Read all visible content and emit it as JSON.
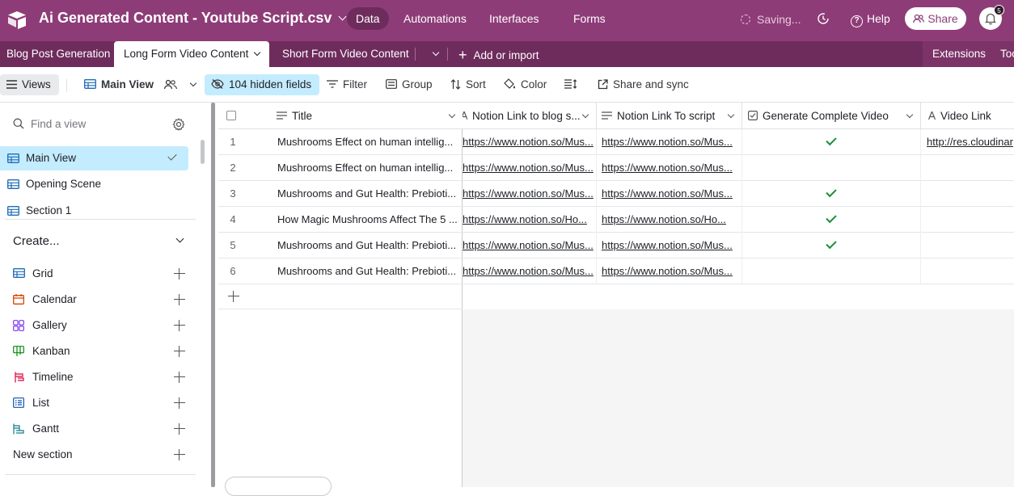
{
  "app": {
    "base_title": "Ai Generated Content - Youtube Script.csv",
    "nav": [
      "Data",
      "Automations",
      "Interfaces",
      "Forms"
    ],
    "saving": "Saving...",
    "help": "Help",
    "share": "Share",
    "notification_count": "5",
    "accent": "#8e3c78"
  },
  "tabs": {
    "items": [
      "Blog Post Generation",
      "Long Form Video Content",
      "Short Form Video Content"
    ],
    "active": "Long Form Video Content",
    "add_import": "Add or import",
    "extensions": "Extensions",
    "tools": "Too"
  },
  "toolbar": {
    "views": "Views",
    "view_name": "Main View",
    "hidden_fields": "104 hidden fields",
    "filter": "Filter",
    "group": "Group",
    "sort": "Sort",
    "color": "Color",
    "share_sync": "Share and sync"
  },
  "sidebar": {
    "find_placeholder": "Find a view",
    "views": [
      "Main View",
      "Opening Scene",
      "Section 1"
    ],
    "create_label": "Create...",
    "create_items": [
      {
        "label": "Grid",
        "icon": "grid-icon"
      },
      {
        "label": "Calendar",
        "icon": "calendar-icon"
      },
      {
        "label": "Gallery",
        "icon": "gallery-icon"
      },
      {
        "label": "Kanban",
        "icon": "kanban-icon"
      },
      {
        "label": "Timeline",
        "icon": "timeline-icon"
      },
      {
        "label": "List",
        "icon": "list-icon"
      },
      {
        "label": "Gantt",
        "icon": "gantt-icon"
      }
    ],
    "new_section": "New section"
  },
  "grid": {
    "columns": [
      "Title",
      "Notion Link to blog s...",
      "Notion Link To script",
      "Generate Complete Video",
      "Video Link"
    ],
    "rows": [
      {
        "num": "1",
        "title": "Mushrooms Effect on human intellig...",
        "blog": "https://www.notion.so/Mus...",
        "script": "https://www.notion.so/Mus...",
        "generate": true,
        "video": "http://res.cloudinar"
      },
      {
        "num": "2",
        "title": "Mushrooms Effect on human intellig...",
        "blog": "https://www.notion.so/Mus...",
        "script": "https://www.notion.so/Mus...",
        "generate": false,
        "video": ""
      },
      {
        "num": "3",
        "title": "Mushrooms and Gut Health: Prebioti...",
        "blog": "https://www.notion.so/Mus...",
        "script": "https://www.notion.so/Mus...",
        "generate": true,
        "video": ""
      },
      {
        "num": "4",
        "title": "How Magic Mushrooms Affect The 5 ...",
        "blog": "https://www.notion.so/Ho...",
        "script": "https://www.notion.so/Ho...",
        "generate": true,
        "video": ""
      },
      {
        "num": "5",
        "title": "Mushrooms and Gut Health: Prebioti...",
        "blog": "https://www.notion.so/Mus...",
        "script": "https://www.notion.so/Mus...",
        "generate": true,
        "video": ""
      },
      {
        "num": "6",
        "title": "Mushrooms and Gut Health: Prebioti...",
        "blog": "https://www.notion.so/Mus...",
        "script": "https://www.notion.so/Mus...",
        "generate": false,
        "video": ""
      }
    ]
  }
}
